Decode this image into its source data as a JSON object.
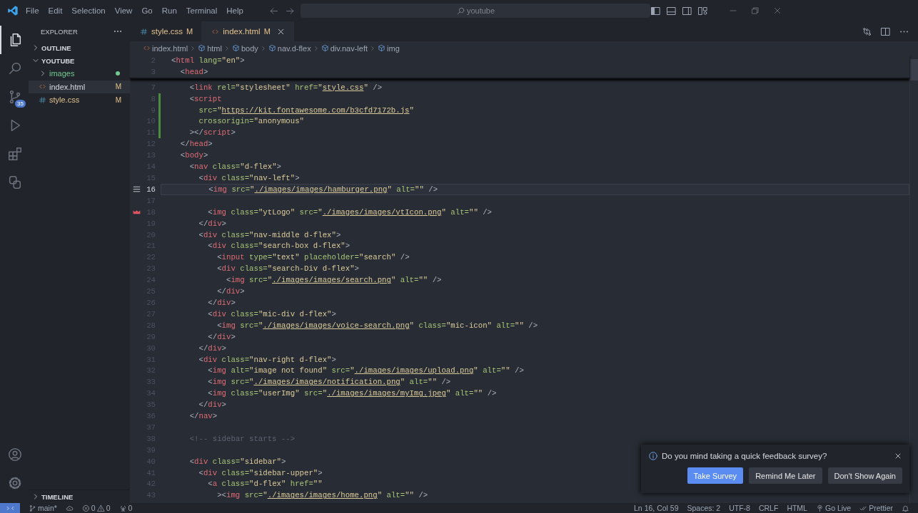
{
  "title_bar": {
    "menu": [
      "File",
      "Edit",
      "Selection",
      "View",
      "Go",
      "Run",
      "Terminal",
      "Help"
    ],
    "search": {
      "value": "youtube"
    }
  },
  "activity_bar": {
    "items": [
      {
        "kind": "files",
        "selected": true
      },
      {
        "kind": "search",
        "selected": false
      },
      {
        "kind": "scm",
        "selected": false,
        "badge": "35"
      },
      {
        "kind": "run",
        "selected": false
      },
      {
        "kind": "extensions",
        "selected": false
      },
      {
        "kind": "shapes",
        "selected": false
      }
    ],
    "bottom_items": [
      {
        "kind": "account"
      },
      {
        "kind": "settings"
      }
    ]
  },
  "sidebar": {
    "title": "EXPLORER",
    "sections": [
      {
        "label": "OUTLINE",
        "expanded": false
      },
      {
        "label": "YOUTUBE",
        "expanded": true,
        "children": [
          {
            "label": "images",
            "kind": "folder",
            "expanded": false,
            "selected": false,
            "modified": false,
            "color": "#73c991"
          },
          {
            "label": "index.html",
            "kind": "html",
            "selected": true,
            "modified": true,
            "badge": "M"
          },
          {
            "label": "style.css",
            "kind": "css",
            "selected": false,
            "modified": true,
            "badge": "M"
          }
        ]
      },
      {
        "label": "TIMELINE",
        "expanded": false
      }
    ]
  },
  "editor": {
    "tabs": [
      {
        "label": "style.css",
        "kind": "css",
        "badge": "M",
        "selected": false
      },
      {
        "label": "index.html",
        "kind": "html",
        "badge": "M",
        "selected": true
      }
    ],
    "breadcrumb": [
      {
        "label": "index.html",
        "kind": "file"
      },
      {
        "label": "html",
        "kind": "element"
      },
      {
        "label": "body",
        "kind": "element"
      },
      {
        "label": "nav.d-flex",
        "kind": "element"
      },
      {
        "label": "div.nav-left",
        "kind": "element"
      },
      {
        "label": "img",
        "kind": "element"
      }
    ],
    "sticky_lines": [
      {
        "n": "2",
        "tokens": [
          {
            "kind": "punct",
            "text": "<"
          },
          {
            "kind": "tag",
            "text": "html"
          },
          {
            "kind": "attr",
            "text": " lang="
          },
          {
            "kind": "string",
            "text": "\"en\""
          },
          {
            "kind": "punct",
            "text": ">"
          }
        ]
      },
      {
        "n": "3",
        "tokens": [
          {
            "kind": "punct",
            "text": "  <"
          },
          {
            "kind": "tag",
            "text": "head"
          },
          {
            "kind": "punct",
            "text": ">"
          }
        ]
      }
    ],
    "lines": [
      {
        "n": "7",
        "current": false,
        "modified": false,
        "tokens": [
          {
            "kind": "punct",
            "text": "    <"
          },
          {
            "kind": "tag",
            "text": "link"
          },
          {
            "kind": "attr",
            "text": " rel="
          },
          {
            "kind": "string",
            "text": "\"stylesheet\""
          },
          {
            "kind": "attr",
            "text": " href="
          },
          {
            "kind": "string",
            "text": "\""
          },
          {
            "kind": "link",
            "text": "style.css"
          },
          {
            "kind": "string",
            "text": "\""
          },
          {
            "kind": "punct",
            "text": " />"
          }
        ]
      },
      {
        "n": "8",
        "current": false,
        "modified": true,
        "tokens": [
          {
            "kind": "punct",
            "text": "    <"
          },
          {
            "kind": "tag",
            "text": "script"
          }
        ]
      },
      {
        "n": "9",
        "current": false,
        "modified": true,
        "tokens": [
          {
            "kind": "attr",
            "text": "      src="
          },
          {
            "kind": "string",
            "text": "\""
          },
          {
            "kind": "link",
            "text": "https://kit.fontawesome.com/b3cfd7172b.js"
          },
          {
            "kind": "string",
            "text": "\""
          }
        ]
      },
      {
        "n": "10",
        "current": false,
        "modified": true,
        "tokens": [
          {
            "kind": "attr",
            "text": "      crossorigin="
          },
          {
            "kind": "string",
            "text": "\"anonymous\""
          }
        ]
      },
      {
        "n": "11",
        "current": false,
        "modified": true,
        "tokens": [
          {
            "kind": "punct",
            "text": "    ></"
          },
          {
            "kind": "tag",
            "text": "script"
          },
          {
            "kind": "punct",
            "text": ">"
          }
        ]
      },
      {
        "n": "12",
        "current": false,
        "modified": false,
        "tokens": [
          {
            "kind": "punct",
            "text": "  </"
          },
          {
            "kind": "tag",
            "text": "head"
          },
          {
            "kind": "punct",
            "text": ">"
          }
        ]
      },
      {
        "n": "13",
        "current": false,
        "modified": false,
        "tokens": [
          {
            "kind": "punct",
            "text": "  <"
          },
          {
            "kind": "tag",
            "text": "body"
          },
          {
            "kind": "punct",
            "text": ">"
          }
        ]
      },
      {
        "n": "14",
        "current": false,
        "modified": false,
        "tokens": [
          {
            "kind": "punct",
            "text": "    <"
          },
          {
            "kind": "tag",
            "text": "nav"
          },
          {
            "kind": "attr",
            "text": " class="
          },
          {
            "kind": "string",
            "text": "\"d-flex\""
          },
          {
            "kind": "punct",
            "text": ">"
          }
        ]
      },
      {
        "n": "15",
        "current": false,
        "modified": false,
        "tokens": [
          {
            "kind": "punct",
            "text": "      <"
          },
          {
            "kind": "tag",
            "text": "div"
          },
          {
            "kind": "attr",
            "text": " class="
          },
          {
            "kind": "string",
            "text": "\"nav-left\""
          },
          {
            "kind": "punct",
            "text": ">"
          }
        ]
      },
      {
        "n": "16",
        "current": true,
        "modified": false,
        "kind": "menu",
        "tokens": [
          {
            "kind": "punct",
            "text": "        <"
          },
          {
            "kind": "tag",
            "text": "img"
          },
          {
            "kind": "attr",
            "text": " src="
          },
          {
            "kind": "string",
            "text": "\""
          },
          {
            "kind": "link",
            "text": "./images/images/hamburger.png"
          },
          {
            "kind": "string",
            "text": "\""
          },
          {
            "kind": "attr",
            "text": " alt="
          },
          {
            "kind": "string",
            "text": "\"\""
          },
          {
            "kind": "punct",
            "text": " />"
          }
        ]
      },
      {
        "n": "17",
        "current": false,
        "modified": false
      },
      {
        "n": "18",
        "current": false,
        "modified": false,
        "kind": "error",
        "tokens": [
          {
            "kind": "punct",
            "text": "        <"
          },
          {
            "kind": "tag",
            "text": "img"
          },
          {
            "kind": "attr",
            "text": " class="
          },
          {
            "kind": "string",
            "text": "\"ytLogo\""
          },
          {
            "kind": "attr",
            "text": " src="
          },
          {
            "kind": "string",
            "text": "\""
          },
          {
            "kind": "link",
            "text": "./images/images/ytIcon.png"
          },
          {
            "kind": "string",
            "text": "\""
          },
          {
            "kind": "attr",
            "text": " alt="
          },
          {
            "kind": "string",
            "text": "\"\""
          },
          {
            "kind": "punct",
            "text": " />"
          }
        ]
      },
      {
        "n": "19",
        "current": false,
        "modified": false,
        "tokens": [
          {
            "kind": "punct",
            "text": "      </"
          },
          {
            "kind": "tag",
            "text": "div"
          },
          {
            "kind": "punct",
            "text": ">"
          }
        ]
      },
      {
        "n": "20",
        "current": false,
        "modified": false,
        "tokens": [
          {
            "kind": "punct",
            "text": "      <"
          },
          {
            "kind": "tag",
            "text": "div"
          },
          {
            "kind": "attr",
            "text": " class="
          },
          {
            "kind": "string",
            "text": "\"nav-middle d-flex\""
          },
          {
            "kind": "punct",
            "text": ">"
          }
        ]
      },
      {
        "n": "21",
        "current": false,
        "modified": false,
        "tokens": [
          {
            "kind": "punct",
            "text": "        <"
          },
          {
            "kind": "tag",
            "text": "div"
          },
          {
            "kind": "attr",
            "text": " class="
          },
          {
            "kind": "string",
            "text": "\"search-box d-flex\""
          },
          {
            "kind": "punct",
            "text": ">"
          }
        ]
      },
      {
        "n": "22",
        "current": false,
        "modified": false,
        "tokens": [
          {
            "kind": "punct",
            "text": "          <"
          },
          {
            "kind": "tag",
            "text": "input"
          },
          {
            "kind": "attr",
            "text": " type="
          },
          {
            "kind": "string",
            "text": "\"text\""
          },
          {
            "kind": "attr",
            "text": " placeholder="
          },
          {
            "kind": "string",
            "text": "\"search\""
          },
          {
            "kind": "punct",
            "text": " />"
          }
        ]
      },
      {
        "n": "23",
        "current": false,
        "modified": false,
        "tokens": [
          {
            "kind": "punct",
            "text": "          <"
          },
          {
            "kind": "tag",
            "text": "div"
          },
          {
            "kind": "attr",
            "text": " class="
          },
          {
            "kind": "string",
            "text": "\"search-Div d-flex\""
          },
          {
            "kind": "punct",
            "text": ">"
          }
        ]
      },
      {
        "n": "24",
        "current": false,
        "modified": false,
        "tokens": [
          {
            "kind": "punct",
            "text": "            <"
          },
          {
            "kind": "tag",
            "text": "img"
          },
          {
            "kind": "attr",
            "text": " src="
          },
          {
            "kind": "string",
            "text": "\""
          },
          {
            "kind": "link",
            "text": "./images/images/search.png"
          },
          {
            "kind": "string",
            "text": "\""
          },
          {
            "kind": "attr",
            "text": " alt="
          },
          {
            "kind": "string",
            "text": "\"\""
          },
          {
            "kind": "punct",
            "text": " />"
          }
        ]
      },
      {
        "n": "25",
        "current": false,
        "modified": false,
        "tokens": [
          {
            "kind": "punct",
            "text": "          </"
          },
          {
            "kind": "tag",
            "text": "div"
          },
          {
            "kind": "punct",
            "text": ">"
          }
        ]
      },
      {
        "n": "26",
        "current": false,
        "modified": false,
        "tokens": [
          {
            "kind": "punct",
            "text": "        </"
          },
          {
            "kind": "tag",
            "text": "div"
          },
          {
            "kind": "punct",
            "text": ">"
          }
        ]
      },
      {
        "n": "27",
        "current": false,
        "modified": false,
        "tokens": [
          {
            "kind": "punct",
            "text": "        <"
          },
          {
            "kind": "tag",
            "text": "div"
          },
          {
            "kind": "attr",
            "text": " class="
          },
          {
            "kind": "string",
            "text": "\"mic-div d-flex\""
          },
          {
            "kind": "punct",
            "text": ">"
          }
        ]
      },
      {
        "n": "28",
        "current": false,
        "modified": false,
        "tokens": [
          {
            "kind": "punct",
            "text": "          <"
          },
          {
            "kind": "tag",
            "text": "img"
          },
          {
            "kind": "attr",
            "text": " src="
          },
          {
            "kind": "string",
            "text": "\""
          },
          {
            "kind": "link",
            "text": "./images/images/voice-search.png"
          },
          {
            "kind": "string",
            "text": "\""
          },
          {
            "kind": "attr",
            "text": " class="
          },
          {
            "kind": "string",
            "text": "\"mic-icon\""
          },
          {
            "kind": "attr",
            "text": " alt="
          },
          {
            "kind": "string",
            "text": "\"\""
          },
          {
            "kind": "punct",
            "text": " />"
          }
        ]
      },
      {
        "n": "29",
        "current": false,
        "modified": false,
        "tokens": [
          {
            "kind": "punct",
            "text": "        </"
          },
          {
            "kind": "tag",
            "text": "div"
          },
          {
            "kind": "punct",
            "text": ">"
          }
        ]
      },
      {
        "n": "30",
        "current": false,
        "modified": false,
        "tokens": [
          {
            "kind": "punct",
            "text": "      </"
          },
          {
            "kind": "tag",
            "text": "div"
          },
          {
            "kind": "punct",
            "text": ">"
          }
        ]
      },
      {
        "n": "31",
        "current": false,
        "modified": false,
        "tokens": [
          {
            "kind": "punct",
            "text": "      <"
          },
          {
            "kind": "tag",
            "text": "div"
          },
          {
            "kind": "attr",
            "text": " class="
          },
          {
            "kind": "string",
            "text": "\"nav-right d-flex\""
          },
          {
            "kind": "punct",
            "text": ">"
          }
        ]
      },
      {
        "n": "32",
        "current": false,
        "modified": false,
        "tokens": [
          {
            "kind": "punct",
            "text": "        <"
          },
          {
            "kind": "tag",
            "text": "img"
          },
          {
            "kind": "attr",
            "text": " alt="
          },
          {
            "kind": "string",
            "text": "\"image not found\""
          },
          {
            "kind": "attr",
            "text": " src="
          },
          {
            "kind": "string",
            "text": "\""
          },
          {
            "kind": "link",
            "text": "./images/images/upload.png"
          },
          {
            "kind": "string",
            "text": "\""
          },
          {
            "kind": "attr",
            "text": " alt="
          },
          {
            "kind": "string",
            "text": "\"\""
          },
          {
            "kind": "punct",
            "text": " />"
          }
        ]
      },
      {
        "n": "33",
        "current": false,
        "modified": false,
        "tokens": [
          {
            "kind": "punct",
            "text": "        <"
          },
          {
            "kind": "tag",
            "text": "img"
          },
          {
            "kind": "attr",
            "text": " src="
          },
          {
            "kind": "string",
            "text": "\""
          },
          {
            "kind": "link",
            "text": "./images/images/notification.png"
          },
          {
            "kind": "string",
            "text": "\""
          },
          {
            "kind": "attr",
            "text": " alt="
          },
          {
            "kind": "string",
            "text": "\"\""
          },
          {
            "kind": "punct",
            "text": " />"
          }
        ]
      },
      {
        "n": "34",
        "current": false,
        "modified": false,
        "tokens": [
          {
            "kind": "punct",
            "text": "        <"
          },
          {
            "kind": "tag",
            "text": "img"
          },
          {
            "kind": "attr",
            "text": " class="
          },
          {
            "kind": "string",
            "text": "\"userImg\""
          },
          {
            "kind": "attr",
            "text": " src="
          },
          {
            "kind": "string",
            "text": "\""
          },
          {
            "kind": "link",
            "text": "./images/images/myImg.jpeg"
          },
          {
            "kind": "string",
            "text": "\""
          },
          {
            "kind": "attr",
            "text": " alt="
          },
          {
            "kind": "string",
            "text": "\"\""
          },
          {
            "kind": "punct",
            "text": " />"
          }
        ]
      },
      {
        "n": "35",
        "current": false,
        "modified": false,
        "tokens": [
          {
            "kind": "punct",
            "text": "      </"
          },
          {
            "kind": "tag",
            "text": "div"
          },
          {
            "kind": "punct",
            "text": ">"
          }
        ]
      },
      {
        "n": "36",
        "current": false,
        "modified": false,
        "tokens": [
          {
            "kind": "punct",
            "text": "    </"
          },
          {
            "kind": "tag",
            "text": "nav"
          },
          {
            "kind": "punct",
            "text": ">"
          }
        ]
      },
      {
        "n": "37",
        "current": false,
        "modified": false
      },
      {
        "n": "38",
        "current": false,
        "modified": false,
        "tokens": [
          {
            "kind": "comment",
            "text": "    <!-- sidebar starts -->"
          }
        ]
      },
      {
        "n": "39",
        "current": false,
        "modified": false
      },
      {
        "n": "40",
        "current": false,
        "modified": false,
        "tokens": [
          {
            "kind": "punct",
            "text": "    <"
          },
          {
            "kind": "tag",
            "text": "div"
          },
          {
            "kind": "attr",
            "text": " class="
          },
          {
            "kind": "string",
            "text": "\"sidebar\""
          },
          {
            "kind": "punct",
            "text": ">"
          }
        ]
      },
      {
        "n": "41",
        "current": false,
        "modified": false,
        "tokens": [
          {
            "kind": "punct",
            "text": "      <"
          },
          {
            "kind": "tag",
            "text": "div"
          },
          {
            "kind": "attr",
            "text": " class="
          },
          {
            "kind": "string",
            "text": "\"sidebar-upper\""
          },
          {
            "kind": "punct",
            "text": ">"
          }
        ]
      },
      {
        "n": "42",
        "current": false,
        "modified": false,
        "tokens": [
          {
            "kind": "punct",
            "text": "        <"
          },
          {
            "kind": "tag",
            "text": "a"
          },
          {
            "kind": "attr",
            "text": " class="
          },
          {
            "kind": "string",
            "text": "\"d-flex\""
          },
          {
            "kind": "attr",
            "text": " href="
          },
          {
            "kind": "string",
            "text": "\"\""
          }
        ]
      },
      {
        "n": "43",
        "current": false,
        "modified": false,
        "tokens": [
          {
            "kind": "punct",
            "text": "          ><"
          },
          {
            "kind": "tag",
            "text": "img"
          },
          {
            "kind": "attr",
            "text": " src="
          },
          {
            "kind": "string",
            "text": "\""
          },
          {
            "kind": "link",
            "text": "./images/images/home.png"
          },
          {
            "kind": "string",
            "text": "\""
          },
          {
            "kind": "attr",
            "text": " alt="
          },
          {
            "kind": "string",
            "text": "\"\""
          },
          {
            "kind": "punct",
            "text": " />"
          }
        ]
      }
    ]
  },
  "notification": {
    "message": "Do you mind taking a quick feedback survey?",
    "buttons": [
      {
        "label": "Take Survey",
        "primary": true
      },
      {
        "label": "Remind Me Later",
        "primary": false
      },
      {
        "label": "Don't Show Again",
        "primary": false
      }
    ]
  },
  "status_bar": {
    "left": [
      {
        "kind": "remote"
      },
      {
        "kind": "branch",
        "text": "main*"
      },
      {
        "kind": "sync"
      },
      {
        "kind": "problems",
        "errors": "0",
        "warnings": "0"
      },
      {
        "kind": "ports",
        "text": "0"
      }
    ],
    "right": [
      {
        "kind": "text",
        "text": "Ln 16, Col 59"
      },
      {
        "kind": "text",
        "text": "Spaces: 2"
      },
      {
        "kind": "text",
        "text": "UTF-8"
      },
      {
        "kind": "text",
        "text": "CRLF"
      },
      {
        "kind": "text",
        "text": "HTML"
      },
      {
        "kind": "golive",
        "text": "Go Live"
      },
      {
        "kind": "prettier",
        "text": "Prettier"
      },
      {
        "kind": "bell"
      }
    ]
  }
}
